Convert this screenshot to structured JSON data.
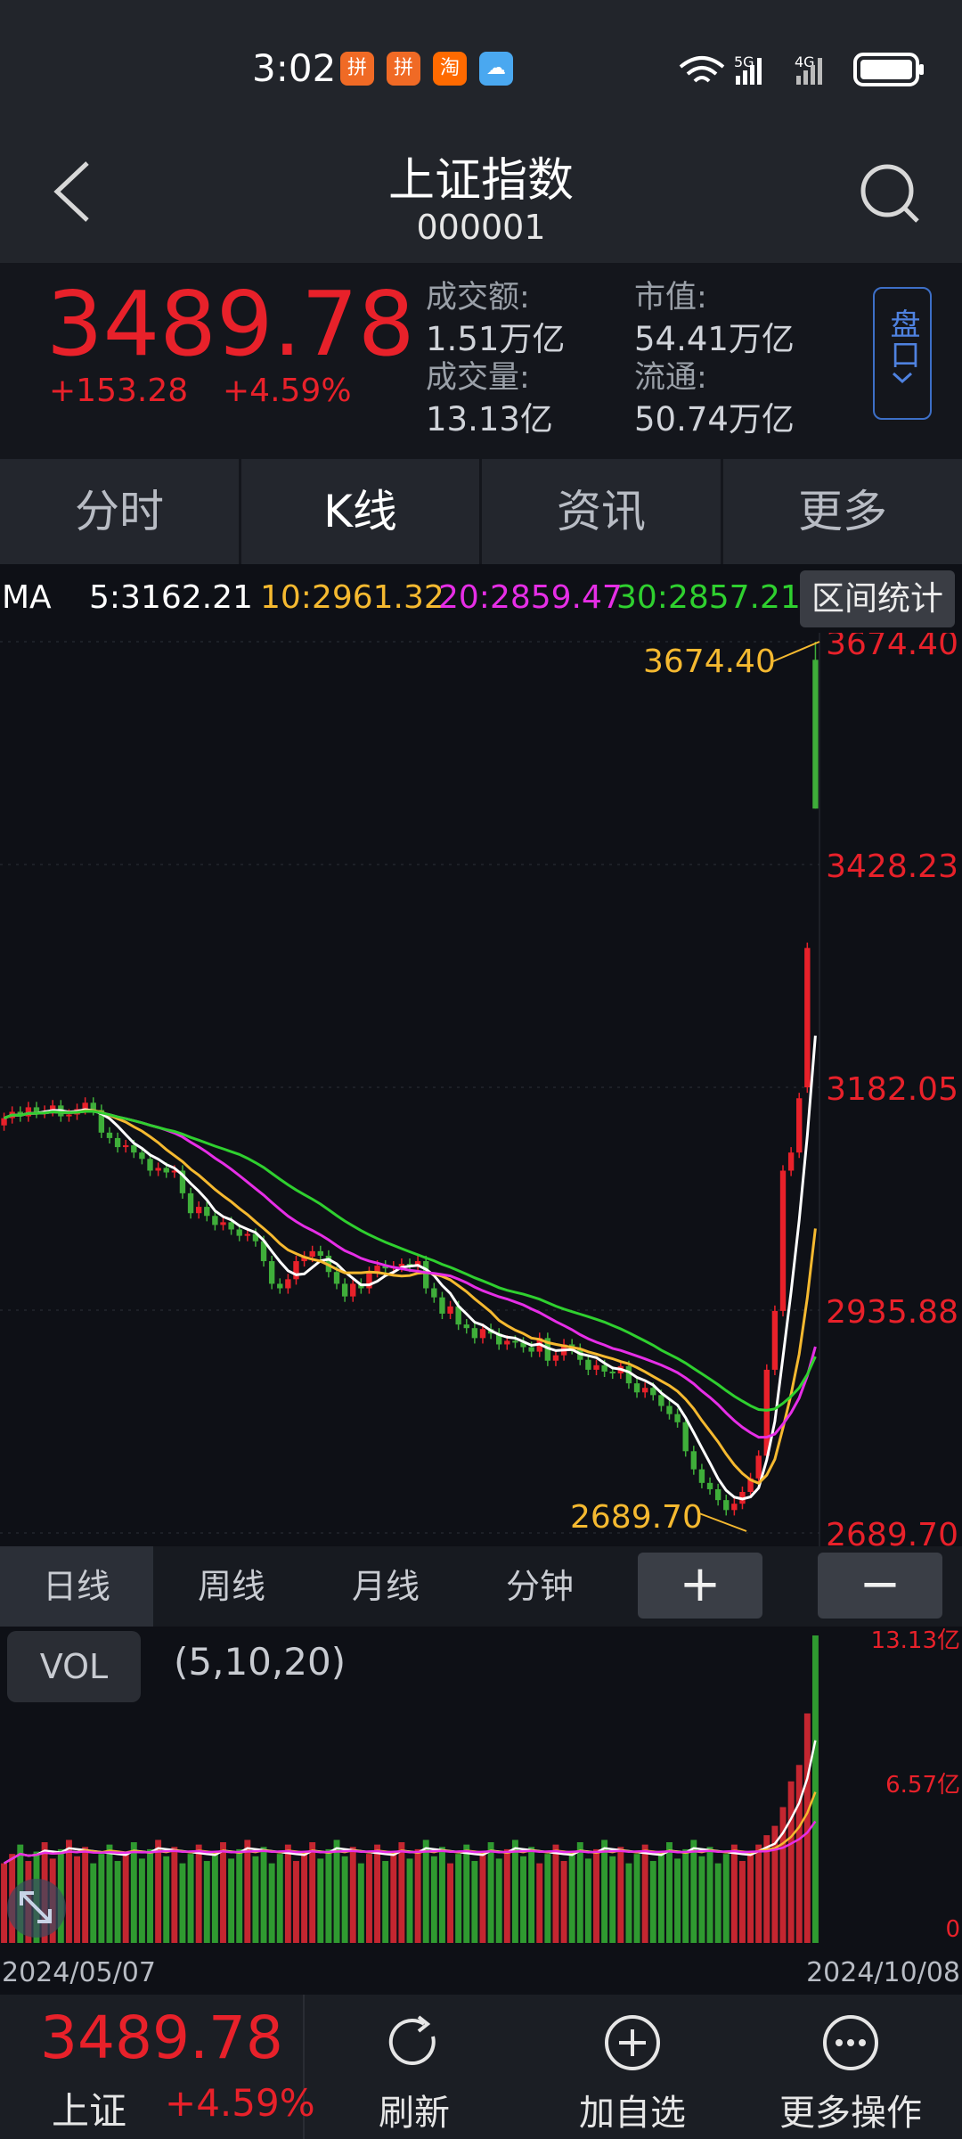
{
  "status_bar": {
    "time": "3:02",
    "app_icons": [
      "拼",
      "拼",
      "淘",
      "☁"
    ],
    "network_5g": "5G",
    "network_4g": "4G"
  },
  "header": {
    "title": "上证指数",
    "code": "000001"
  },
  "quote": {
    "price": "3489.78",
    "change": "+153.28",
    "change_pct": "+4.59%",
    "turnover_label": "成交额:",
    "turnover_value": "1.51万亿",
    "volume_label": "成交量:",
    "volume_value": "13.13亿",
    "market_cap_label": "市值:",
    "market_cap_value": "54.41万亿",
    "float_label": "流通:",
    "float_value": "50.74万亿",
    "pankou_label": "盘口"
  },
  "tabs": [
    "分时",
    "K线",
    "资讯",
    "更多"
  ],
  "ma": {
    "label": "MA",
    "ma5": "5:3162.21",
    "ma10": "10:2961.32",
    "ma20": "20:2859.47",
    "ma30": "30:2857.21",
    "range_button": "区间统计"
  },
  "chart_labels": {
    "y_ticks": [
      "3674.40",
      "3428.23",
      "3182.05",
      "2935.88",
      "2689.70"
    ],
    "high_marker": "3674.40",
    "low_marker": "2689.70",
    "vol_ticks": [
      "13.13亿",
      "6.57亿",
      "0"
    ]
  },
  "period_tabs": [
    "日线",
    "周线",
    "月线",
    "分钟"
  ],
  "zoom": {
    "plus": "+",
    "minus": "−"
  },
  "volume": {
    "label": "VOL",
    "params": "(5,10,20)"
  },
  "dates": {
    "start": "2024/05/07",
    "end": "2024/10/08"
  },
  "bottom": {
    "price": "3489.78",
    "name": "上证",
    "pct": "+4.59%",
    "refresh": "刷新",
    "add_watch": "加自选",
    "more_ops": "更多操作"
  },
  "colors": {
    "up": "#e8212a",
    "down": "#3fae3a",
    "ma5": "#ffffff",
    "ma10": "#f5b930",
    "ma20": "#e62ee6",
    "ma30": "#2fd02f"
  },
  "chart_data": {
    "type": "candlestick",
    "x_range": [
      "2024/05/07",
      "2024/10/08"
    ],
    "ylim": [
      2689.7,
      3674.4
    ],
    "y_ticks": [
      3674.4,
      3428.23,
      3182.05,
      2935.88,
      2689.7
    ],
    "high": 3674.4,
    "low": 2689.7,
    "closes": [
      3148,
      3155,
      3150,
      3160,
      3154,
      3156,
      3162,
      3150,
      3152,
      3158,
      3165,
      3157,
      3132,
      3126,
      3116,
      3118,
      3110,
      3103,
      3090,
      3093,
      3088,
      3090,
      3065,
      3043,
      3050,
      3040,
      3030,
      3033,
      3025,
      3018,
      3020,
      3012,
      2990,
      2965,
      2960,
      2970,
      2990,
      2995,
      3001,
      2996,
      2978,
      2965,
      2951,
      2965,
      2960,
      2978,
      2985,
      2982,
      2984,
      2987,
      2984,
      2990,
      2960,
      2950,
      2932,
      2940,
      2920,
      2916,
      2905,
      2915,
      2910,
      2898,
      2902,
      2900,
      2895,
      2890,
      2905,
      2880,
      2886,
      2898,
      2893,
      2881,
      2870,
      2875,
      2868,
      2866,
      2874,
      2855,
      2845,
      2850,
      2842,
      2830,
      2821,
      2812,
      2780,
      2760,
      2745,
      2738,
      2726,
      2715,
      2722,
      2735,
      2750,
      2775,
      2870,
      2935,
      3090,
      3110,
      3170,
      3336,
      3490
    ],
    "volume_ylim": [
      0,
      13.13
    ],
    "volume_ticks": [
      13.13,
      6.57,
      0
    ]
  }
}
